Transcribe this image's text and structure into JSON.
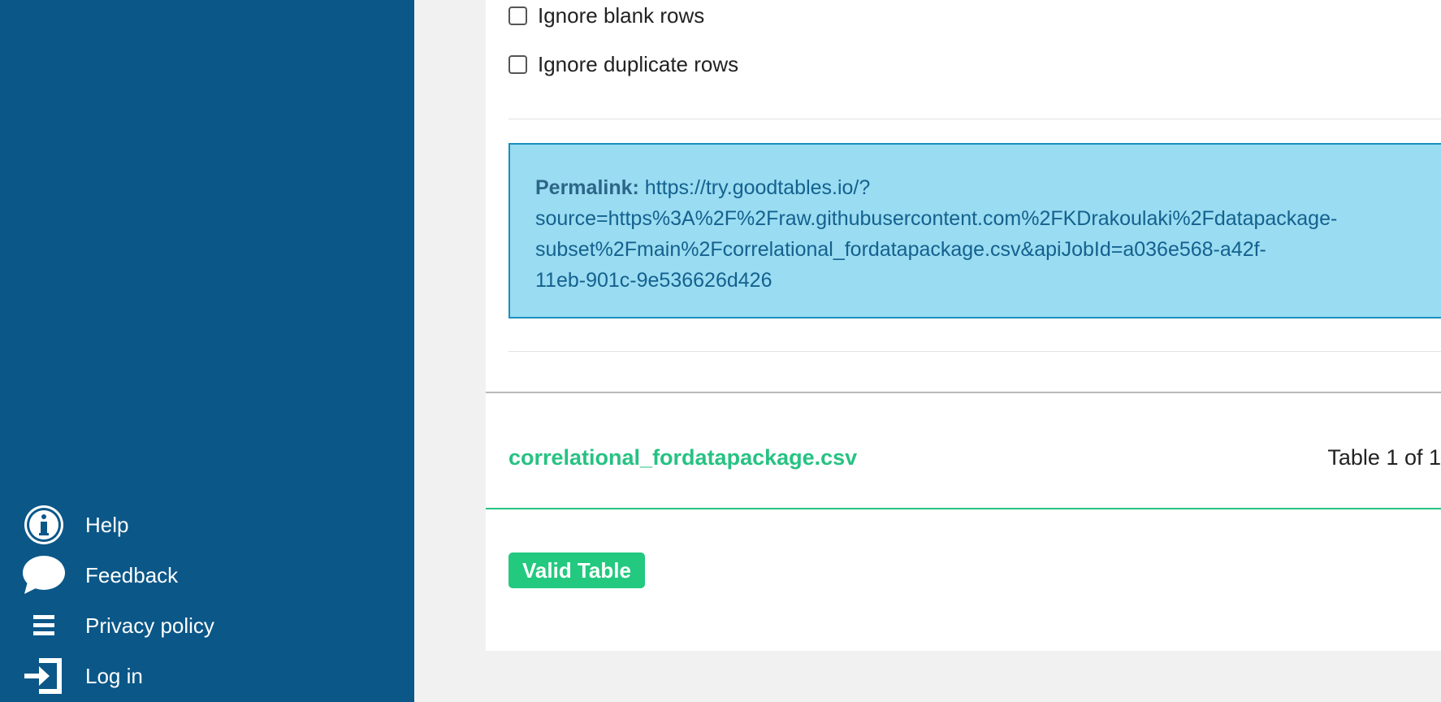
{
  "sidebar": {
    "items": [
      {
        "label": "Help",
        "icon": "info-icon"
      },
      {
        "label": "Feedback",
        "icon": "speech-bubble-icon"
      },
      {
        "label": "Privacy policy",
        "icon": "list-icon"
      },
      {
        "label": "Log in",
        "icon": "login-icon"
      }
    ]
  },
  "options": {
    "ignore_blank_rows": "Ignore blank rows",
    "ignore_duplicate_rows": "Ignore duplicate rows"
  },
  "permalink": {
    "label": "Permalink:",
    "url": "https://try.goodtables.io/?\nsource=https%3A%2F%2Fraw.githubusercontent.com%2FKDrakoulaki%2Fdatapackage-\nsubset%2Fmain%2Fcorrelational_fordatapackage.csv&apiJobId=a036e568-a42f-\n11eb-901c-9e536626d426"
  },
  "report": {
    "file_name": "correlational_fordatapackage.csv",
    "table_count": "Table 1 of 1",
    "status_badge": "Valid Table"
  },
  "colors": {
    "sidebar": "#0b5788",
    "accent_green": "#27c283",
    "alert_bg": "#9adcf1"
  }
}
